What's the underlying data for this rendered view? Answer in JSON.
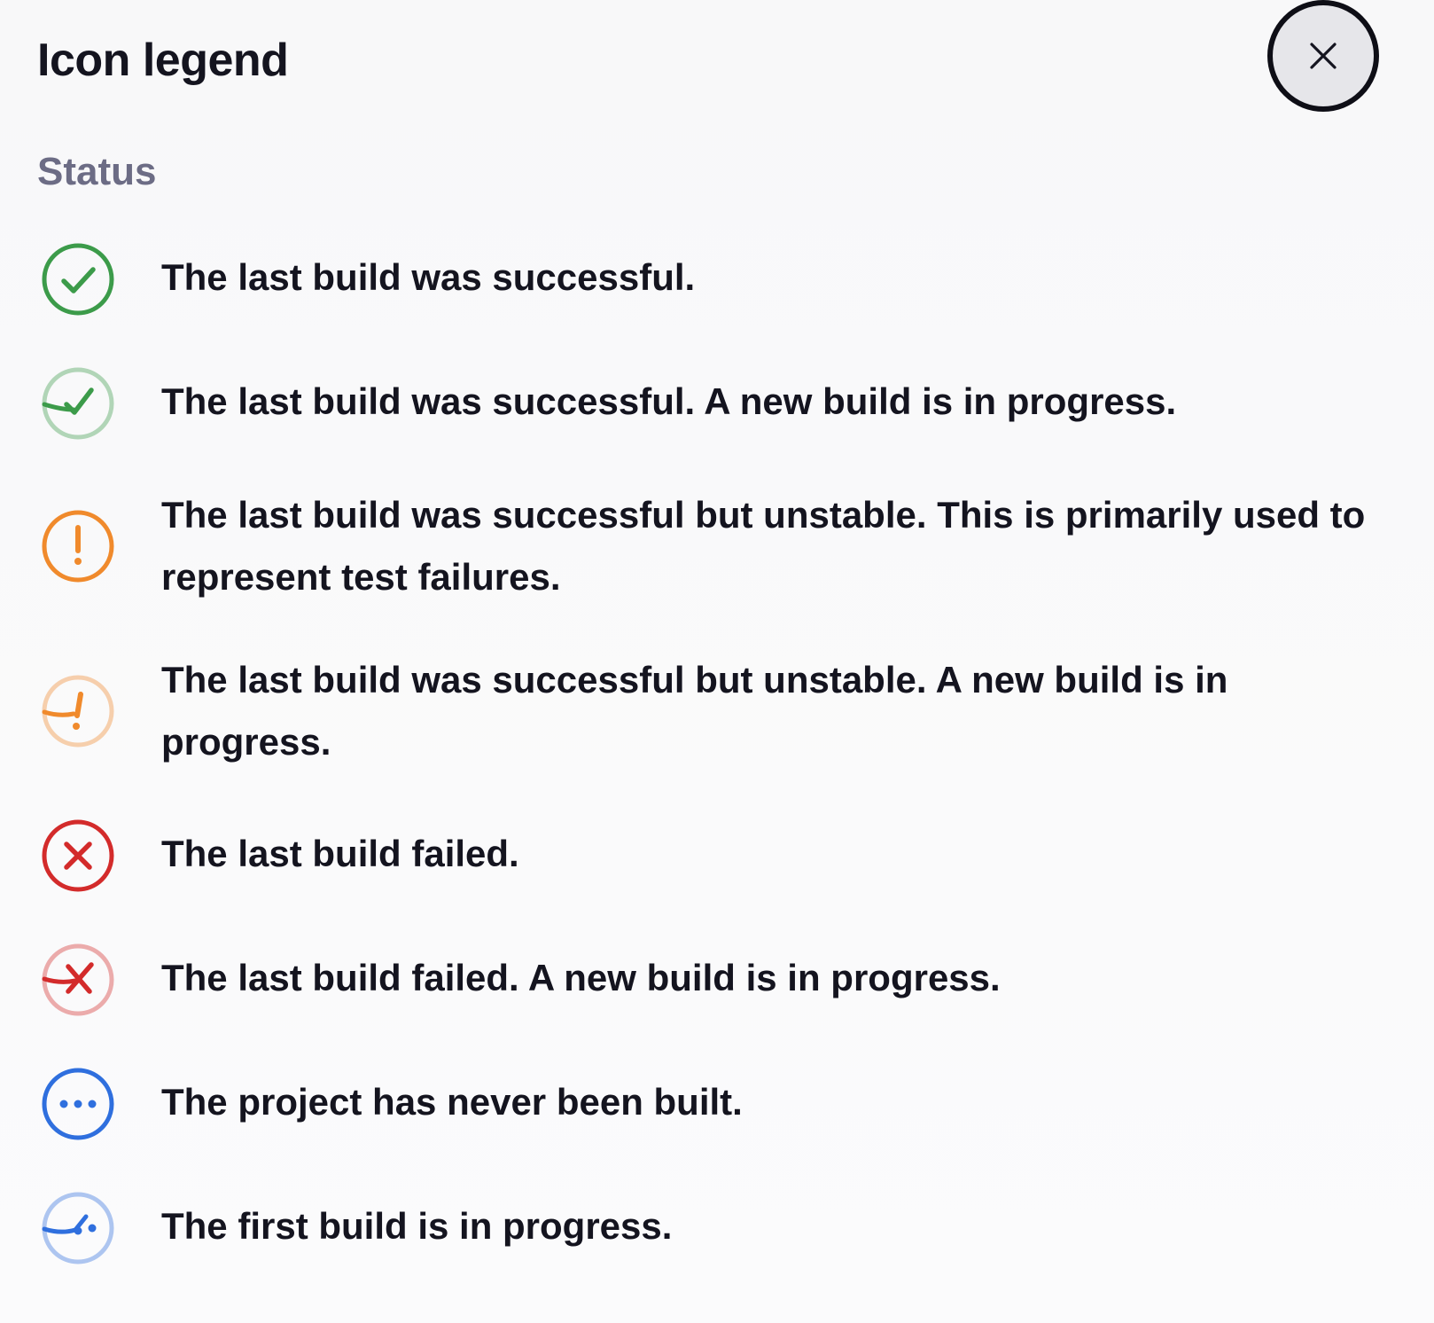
{
  "dialog": {
    "title": "Icon legend",
    "close_icon": "close-icon"
  },
  "status_section": {
    "heading": "Status",
    "items": [
      {
        "icon": "success-icon",
        "color": "#3c9b4a",
        "text": "The last build was successful."
      },
      {
        "icon": "success-in-progress-icon",
        "color": "#3c9b4a",
        "text": "The last build was successful. A new build is in progress."
      },
      {
        "icon": "unstable-icon",
        "color": "#f08a2c",
        "text": "The last build was successful but unstable. This is primarily used to represent test failures."
      },
      {
        "icon": "unstable-in-progress-icon",
        "color": "#f08a2c",
        "text": "The last build was successful but unstable. A new build is in progress."
      },
      {
        "icon": "failed-icon",
        "color": "#d32b2b",
        "text": "The last build failed."
      },
      {
        "icon": "failed-in-progress-icon",
        "color": "#d32b2b",
        "text": "The last build failed. A new build is in progress."
      },
      {
        "icon": "not-built-icon",
        "color": "#2f6fde",
        "text": "The project has never been built."
      },
      {
        "icon": "first-build-in-progress-icon",
        "color": "#2f6fde",
        "text": "The first build is in progress."
      }
    ]
  }
}
